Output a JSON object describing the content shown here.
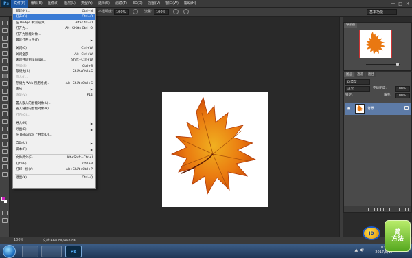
{
  "app": {
    "logo": "Ps"
  },
  "menubar": {
    "items": [
      "文件(F)",
      "编辑(E)",
      "图像(I)",
      "图层(L)",
      "类型(Y)",
      "选择(S)",
      "滤镜(T)",
      "3D(D)",
      "视图(V)",
      "窗口(W)",
      "帮助(H)"
    ],
    "window_controls": [
      "—",
      "□",
      "✕"
    ]
  },
  "optionsbar": {
    "opacity_label": "不透明度:",
    "opacity_value": "100%",
    "flow_label": "流量:",
    "flow_value": "100%",
    "workspace": "基本功能"
  },
  "file_menu": {
    "items": [
      {
        "label": "新建(N)...",
        "shortcut": "Ctrl+N",
        "disabled": false
      },
      {
        "label": "打开(O)...",
        "shortcut": "Ctrl+O",
        "disabled": false,
        "highlight": true
      },
      {
        "label": "在 Bridge 中浏览(B)...",
        "shortcut": "Alt+Ctrl+O",
        "disabled": false
      },
      {
        "label": "打开为...",
        "shortcut": "Alt+Shift+Ctrl+O",
        "disabled": false
      },
      {
        "label": "打开为智能对象...",
        "shortcut": "",
        "disabled": false
      },
      {
        "label": "最近打开文件(T)",
        "shortcut": "",
        "disabled": false,
        "submenu": true
      },
      {
        "label": "关闭(C)",
        "shortcut": "Ctrl+W",
        "disabled": false
      },
      {
        "label": "关闭全部",
        "shortcut": "Alt+Ctrl+W",
        "disabled": false
      },
      {
        "label": "关闭并转到 Bridge...",
        "shortcut": "Shift+Ctrl+W",
        "disabled": false
      },
      {
        "label": "存储(S)",
        "shortcut": "Ctrl+S",
        "disabled": true
      },
      {
        "label": "存储为(A)...",
        "shortcut": "Shift+Ctrl+S",
        "disabled": false
      },
      {
        "label": "签入(I)...",
        "shortcut": "",
        "disabled": true
      },
      {
        "label": "存储为 Web 所用格式...",
        "shortcut": "Alt+Shift+Ctrl+S",
        "disabled": false
      },
      {
        "label": "生成",
        "shortcut": "",
        "disabled": false,
        "submenu": true
      },
      {
        "label": "恢复(V)",
        "shortcut": "F12",
        "disabled": true
      },
      {
        "label": "置入嵌入的智能对象(L)...",
        "shortcut": "",
        "disabled": false
      },
      {
        "label": "置入链接的智能对象(K)...",
        "shortcut": "",
        "disabled": false
      },
      {
        "label": "打包(G)...",
        "shortcut": "",
        "disabled": true
      },
      {
        "label": "导入(M)",
        "shortcut": "",
        "disabled": false,
        "submenu": true
      },
      {
        "label": "导出(E)",
        "shortcut": "",
        "disabled": false,
        "submenu": true
      },
      {
        "label": "在 Behance 上共享(D)...",
        "shortcut": "",
        "disabled": false
      },
      {
        "label": "自动(U)",
        "shortcut": "",
        "disabled": false,
        "submenu": true
      },
      {
        "label": "脚本(R)",
        "shortcut": "",
        "disabled": false,
        "submenu": true
      },
      {
        "label": "文件简介(F)...",
        "shortcut": "Alt+Shift+Ctrl+I",
        "disabled": false
      },
      {
        "label": "打印(P)...",
        "shortcut": "Ctrl+P",
        "disabled": false
      },
      {
        "label": "打印一份(Y)",
        "shortcut": "Alt+Shift+Ctrl+P",
        "disabled": false
      },
      {
        "label": "退出(X)",
        "shortcut": "Ctrl+Q",
        "disabled": false
      }
    ]
  },
  "navigator": {
    "tabs": [
      "导航器"
    ]
  },
  "layers": {
    "tabs": [
      "图层",
      "通道",
      "路径"
    ],
    "kind_label": "p 类型",
    "blend_mode": "正常",
    "opacity_label": "不透明度:",
    "opacity_value": "100%",
    "lock_label": "锁定:",
    "fill_label": "填充:",
    "fill_value": "100%",
    "layer_name": "背景"
  },
  "status": {
    "zoom": "100%",
    "doc": "文档:468.8K/468.8K"
  },
  "taskbar": {
    "task_ps_label": "Ps",
    "time": "10:49",
    "date": "2017/5/17"
  },
  "watermarks": {
    "left": "JD",
    "right_line1": "简",
    "right_line2": "方法"
  },
  "colors": {
    "foreground": "#d020c0",
    "background": "#ffffff",
    "highlight": "#3a7bd5"
  }
}
